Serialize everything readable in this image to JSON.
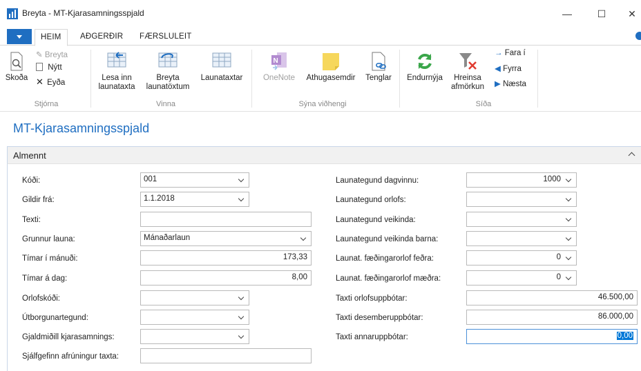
{
  "window": {
    "title": "Breyta - MT-Kjarasamningsspjald",
    "minimize": "—",
    "maximize": "☐",
    "close": "✕"
  },
  "tabs": [
    {
      "label": "HEIM"
    },
    {
      "label": "AÐGERÐIR"
    },
    {
      "label": "FÆRSLULEIT"
    }
  ],
  "ribbon": {
    "skoda": "Skoða",
    "breyta": "Breyta",
    "nytt": "Nýtt",
    "eyda": "Eyða",
    "stjorna": "Stjórna",
    "lesa_inn_1": "Lesa inn",
    "lesa_inn_2": "launataxta",
    "breyta_launatoxtum_1": "Breyta",
    "breyta_launatoxtum_2": "launatöxtum",
    "launataxtar": "Launataxtar",
    "vinna": "Vinna",
    "onenote": "OneNote",
    "athugasemdir": "Athugasemdir",
    "tenglar": "Tenglar",
    "syna_vidhengi": "Sýna viðhengi",
    "endurnyja": "Endurnýja",
    "hreinsa_1": "Hreinsa",
    "hreinsa_2": "afmörkun",
    "fara_i": "Fara í",
    "fyrra": "Fyrra",
    "naesta": "Næsta",
    "sida": "Síða"
  },
  "page": {
    "title": "MT-Kjarasamningsspjald",
    "section": "Almennt"
  },
  "left_fields": [
    {
      "label": "Kóði:",
      "value": "001"
    },
    {
      "label": "Gildir frá:",
      "value": "1.1.2018"
    },
    {
      "label": "Texti:",
      "value": ""
    },
    {
      "label": "Grunnur launa:",
      "value": "Mánaðarlaun"
    },
    {
      "label": "Tímar í mánuði:",
      "value": "173,33"
    },
    {
      "label": "Tímar á dag:",
      "value": "8,00"
    },
    {
      "label": "Orlofskóði:",
      "value": ""
    },
    {
      "label": "Útborgunartegund:",
      "value": ""
    },
    {
      "label": "Gjaldmiðill kjarasamnings:",
      "value": ""
    },
    {
      "label": "Sjálfgefinn afrúningur taxta:",
      "value": ""
    }
  ],
  "right_fields": [
    {
      "label": "Launategund dagvinnu:",
      "value": "1000"
    },
    {
      "label": "Launategund orlofs:",
      "value": ""
    },
    {
      "label": "Launategund veikinda:",
      "value": ""
    },
    {
      "label": "Launategund veikinda barna:",
      "value": ""
    },
    {
      "label": "Launat. fæðingarorlof feðra:",
      "value": "0"
    },
    {
      "label": "Launat. fæðingarorlof mæðra:",
      "value": "0"
    },
    {
      "label": "Taxti orlofsuppbótar:",
      "value": "46.500,00"
    },
    {
      "label": "Taxti desemberuppbótar:",
      "value": "86.000,00"
    },
    {
      "label": "Taxti annaruppbótar:",
      "value": "0,00"
    }
  ],
  "colors": {
    "accent": "#1f6ec1",
    "refresh_green": "#3aa64a",
    "onenote_purple": "#b28bd0",
    "note_yellow": "#f6d75c"
  }
}
